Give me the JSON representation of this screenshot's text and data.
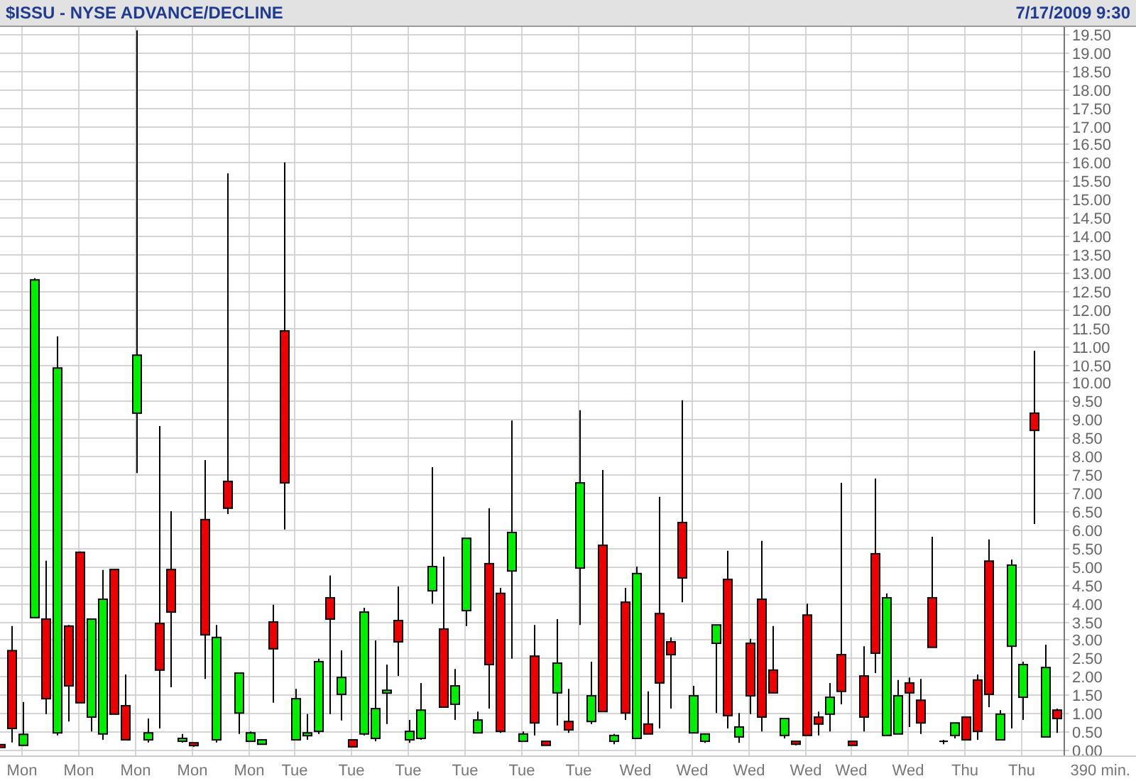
{
  "chart": {
    "date": "7/17/2009 9:30",
    "span_label": "390 min.",
    "chart_data": {
      "type": "candlestick",
      "title": "$ISSU - NYSE ADVANCE/DECLINE",
      "grid": true,
      "categories": [
        null,
        null,
        "Mon",
        null,
        null,
        null,
        null,
        "Mon",
        null,
        null,
        null,
        null,
        "Mon",
        null,
        null,
        null,
        null,
        "Mon",
        null,
        null,
        null,
        null,
        "Mon",
        null,
        null,
        null,
        "Tue",
        null,
        null,
        null,
        null,
        "Tue",
        null,
        null,
        null,
        null,
        "Tue",
        null,
        null,
        null,
        null,
        "Tue",
        null,
        null,
        null,
        null,
        "Tue",
        null,
        null,
        null,
        null,
        "Tue",
        null,
        null,
        null,
        null,
        "Wed",
        null,
        null,
        null,
        null,
        "Wed",
        null,
        null,
        null,
        null,
        "Wed",
        null,
        null,
        null,
        null,
        "Wed",
        null,
        null,
        null,
        "Wed",
        null,
        null,
        null,
        null,
        "Wed",
        null,
        null,
        null,
        null,
        "Thu",
        null,
        null,
        null,
        null,
        "Thu",
        null,
        null,
        null
      ],
      "ylim": [
        -0.155,
        19.69
      ],
      "ohlc": [
        [
          0.14,
          0.14,
          0.06,
          0.08
        ],
        [
          2.7,
          3.37,
          0.2,
          0.58
        ],
        [
          0.12,
          1.3,
          0.1,
          0.42
        ],
        [
          3.6,
          12.85,
          3.6,
          12.8
        ],
        [
          3.56,
          5.15,
          0.97,
          1.39
        ],
        [
          0.46,
          11.26,
          0.39,
          10.4
        ],
        [
          3.37,
          3.4,
          0.77,
          1.74
        ],
        [
          5.38,
          5.4,
          1.28,
          1.28
        ],
        [
          0.89,
          3.56,
          0.5,
          3.56
        ],
        [
          0.43,
          4.9,
          0.27,
          4.1
        ],
        [
          4.91,
          4.91,
          0.97,
          0.97
        ],
        [
          1.2,
          2.05,
          0.27,
          0.27
        ],
        [
          9.17,
          19.6,
          7.54,
          10.75
        ],
        [
          0.27,
          0.85,
          0.2,
          0.46
        ],
        [
          3.44,
          8.82,
          0.58,
          2.17
        ],
        [
          4.91,
          6.5,
          1.7,
          3.75
        ],
        [
          0.23,
          0.43,
          0.2,
          0.31
        ],
        [
          0.19,
          0.19,
          0.08,
          0.12
        ],
        [
          6.27,
          7.89,
          1.93,
          3.13
        ],
        [
          0.27,
          3.4,
          0.2,
          3.06
        ],
        [
          7.31,
          15.7,
          6.42,
          6.58
        ],
        [
          1.0,
          2.09,
          0.43,
          2.09
        ],
        [
          0.23,
          0.5,
          0.23,
          0.46
        ],
        [
          0.15,
          0.27,
          0.15,
          0.27
        ],
        [
          3.48,
          3.95,
          1.28,
          2.75
        ],
        [
          11.41,
          16.0,
          6.0,
          7.27
        ],
        [
          0.27,
          1.66,
          0.27,
          1.39
        ],
        [
          0.39,
          0.97,
          0.27,
          0.46
        ],
        [
          0.5,
          2.48,
          0.43,
          2.4
        ],
        [
          4.14,
          4.75,
          0.97,
          3.56
        ],
        [
          1.51,
          2.71,
          0.8,
          1.97
        ],
        [
          0.27,
          0.27,
          0.08,
          0.08
        ],
        [
          0.43,
          3.87,
          0.39,
          3.75
        ],
        [
          0.31,
          2.98,
          0.23,
          1.12
        ],
        [
          1.55,
          2.32,
          0.7,
          1.62
        ],
        [
          3.52,
          4.45,
          2.01,
          2.94
        ],
        [
          0.27,
          0.81,
          0.19,
          0.5
        ],
        [
          0.31,
          1.82,
          0.27,
          1.08
        ],
        [
          4.33,
          7.7,
          3.98,
          4.99
        ],
        [
          3.29,
          5.26,
          1.16,
          1.16
        ],
        [
          1.24,
          2.2,
          0.81,
          1.74
        ],
        [
          3.79,
          5.76,
          3.37,
          5.76
        ],
        [
          0.46,
          1.04,
          0.46,
          0.81
        ],
        [
          5.07,
          6.58,
          1.12,
          2.32
        ],
        [
          4.26,
          4.41,
          0.46,
          0.5
        ],
        [
          4.87,
          8.97,
          2.48,
          5.92
        ],
        [
          0.23,
          0.5,
          0.23,
          0.43
        ],
        [
          2.55,
          3.4,
          0.39,
          0.73
        ],
        [
          0.23,
          0.23,
          0.12,
          0.12
        ],
        [
          1.55,
          3.56,
          0.66,
          2.36
        ],
        [
          0.77,
          1.66,
          0.46,
          0.54
        ],
        [
          4.95,
          9.25,
          3.4,
          7.27
        ],
        [
          0.77,
          2.4,
          0.7,
          1.47
        ],
        [
          5.57,
          7.62,
          1.04,
          1.04
        ],
        [
          0.23,
          0.43,
          0.15,
          0.39
        ],
        [
          4.02,
          4.41,
          0.81,
          1.0
        ],
        [
          0.31,
          4.99,
          0.31,
          4.8
        ],
        [
          0.7,
          1.59,
          0.43,
          0.43
        ],
        [
          3.71,
          6.89,
          0.58,
          1.82
        ],
        [
          2.94,
          3.06,
          1.12,
          2.59
        ],
        [
          6.19,
          9.52,
          4.02,
          4.68
        ],
        [
          0.46,
          1.74,
          0.46,
          1.47
        ],
        [
          0.23,
          0.43,
          0.19,
          0.43
        ],
        [
          2.9,
          3.4,
          1.0,
          3.4
        ],
        [
          4.64,
          5.42,
          0.58,
          0.93
        ],
        [
          0.35,
          1.0,
          0.19,
          0.62
        ],
        [
          2.9,
          3.02,
          0.97,
          1.47
        ],
        [
          4.1,
          5.69,
          0.5,
          0.89
        ],
        [
          2.17,
          3.37,
          1.55,
          1.55
        ],
        [
          0.39,
          0.85,
          0.31,
          0.85
        ],
        [
          0.23,
          0.23,
          0.12,
          0.15
        ],
        [
          3.67,
          3.98,
          0.39,
          0.39
        ],
        [
          0.89,
          1.04,
          0.39,
          0.7
        ],
        [
          0.97,
          1.82,
          0.5,
          1.43
        ],
        [
          2.59,
          7.27,
          1.24,
          1.59
        ],
        [
          0.23,
          0.23,
          0.12,
          0.12
        ],
        [
          2.01,
          2.82,
          0.5,
          0.89
        ],
        [
          5.34,
          7.39,
          2.09,
          2.63
        ],
        [
          0.39,
          4.26,
          0.39,
          4.14
        ],
        [
          0.43,
          1.9,
          0.43,
          1.47
        ],
        [
          1.82,
          1.97,
          0.62,
          1.55
        ],
        [
          1.35,
          1.93,
          0.43,
          0.73
        ],
        [
          4.14,
          5.8,
          2.79,
          2.79
        ],
        [
          0.23,
          0.27,
          0.15,
          0.23
        ],
        [
          0.39,
          0.73,
          0.31,
          0.73
        ],
        [
          0.89,
          0.89,
          0.27,
          0.27
        ],
        [
          1.9,
          2.05,
          0.27,
          0.5
        ],
        [
          5.14,
          5.73,
          1.16,
          1.51
        ],
        [
          0.27,
          1.08,
          0.27,
          0.97
        ],
        [
          2.82,
          5.18,
          0.58,
          5.03
        ],
        [
          1.43,
          2.4,
          0.81,
          2.32
        ],
        [
          9.17,
          10.87,
          6.15,
          8.7
        ],
        [
          0.35,
          2.86,
          0.35,
          2.24
        ],
        [
          1.08,
          1.12,
          0.46,
          0.85
        ]
      ],
      "yticks": [
        {
          "value": 19.5,
          "label": "19.50"
        },
        {
          "value": 19,
          "label": "19.00"
        },
        {
          "value": 18.5,
          "label": "18.50"
        },
        {
          "value": 18,
          "label": "18.00"
        },
        {
          "value": 17.5,
          "label": "17.50"
        },
        {
          "value": 17,
          "label": "17.00"
        },
        {
          "value": 16.5,
          "label": "16.50"
        },
        {
          "value": 16,
          "label": "16.00"
        },
        {
          "value": 15.5,
          "label": "15.50"
        },
        {
          "value": 15,
          "label": "15.00"
        },
        {
          "value": 14.5,
          "label": "14.50"
        },
        {
          "value": 14,
          "label": "14.00"
        },
        {
          "value": 13.5,
          "label": "13.50"
        },
        {
          "value": 13,
          "label": "13.00"
        },
        {
          "value": 12.5,
          "label": "12.50"
        },
        {
          "value": 12,
          "label": "12.00"
        },
        {
          "value": 11.5,
          "label": "11.50"
        },
        {
          "value": 11,
          "label": "11.00"
        },
        {
          "value": 10.5,
          "label": "10.50"
        },
        {
          "value": 10,
          "label": "10.00"
        },
        {
          "value": 9.5,
          "label": "9.50"
        },
        {
          "value": 9,
          "label": "9.00"
        },
        {
          "value": 8.5,
          "label": "8.50"
        },
        {
          "value": 8,
          "label": "8.00"
        },
        {
          "value": 7.5,
          "label": "7.50"
        },
        {
          "value": 7,
          "label": "7.00"
        },
        {
          "value": 6.5,
          "label": "6.50"
        },
        {
          "value": 6,
          "label": "6.00"
        },
        {
          "value": 5.5,
          "label": "5.50"
        },
        {
          "value": 5,
          "label": "5.00"
        },
        {
          "value": 4.5,
          "label": "4.50"
        },
        {
          "value": 4,
          "label": "4.00"
        },
        {
          "value": 3.5,
          "label": "3.50"
        },
        {
          "value": 3,
          "label": "3.00"
        },
        {
          "value": 2.5,
          "label": "2.50"
        },
        {
          "value": 2,
          "label": "2.00"
        },
        {
          "value": 1.5,
          "label": "1.50"
        },
        {
          "value": 1,
          "label": "1.00"
        },
        {
          "value": 0.5,
          "label": "0.50"
        },
        {
          "value": 0,
          "label": "0.00"
        }
      ]
    }
  }
}
